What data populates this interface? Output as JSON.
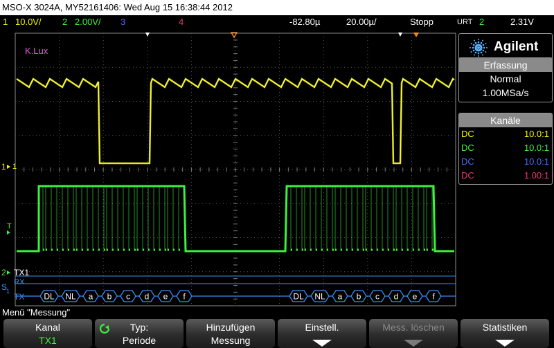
{
  "title_bar": "MSO-X 3024A, MY52161406: Wed Aug 15 16:38:44 2012",
  "status": {
    "ch1_num": "1",
    "ch1_scale": "10.0V/",
    "ch2_num": "2",
    "ch2_scale": "2.00V/",
    "ch3_num": "3",
    "ch4_num": "4",
    "delay": "-82.80µ",
    "timebase": "20.00µ/",
    "run_state": "Stopp",
    "trigger_label": "URT",
    "trigger_channel": "2",
    "trigger_level": "2.31V"
  },
  "colors": {
    "ch1": "#f2f200",
    "ch2": "#3cf23c",
    "ch3": "#4a6cf7",
    "ch4": "#f0357a",
    "serial_blue": "#3b8ff0",
    "trigger_orange": "#f08a20",
    "label_magenta": "#e060e0"
  },
  "screen": {
    "annotation": "K.Lux",
    "ch1_marker": "1",
    "ch2_marker": "2",
    "trigger_marker": "T",
    "serial_tx_label": "TX1",
    "serial_rx_label": "RX",
    "serial_tx_row": "TX",
    "serial_marker": "S",
    "serial_marker_sub": "1"
  },
  "decode_packets": [
    [
      "DL",
      "NL",
      "a",
      "b",
      "c",
      "d",
      "e",
      "f"
    ],
    [
      "DL",
      "NL",
      "a",
      "b",
      "c",
      "d",
      "e",
      "f"
    ]
  ],
  "side_panel": {
    "brand": "Agilent",
    "acquisition_header": "Erfassung",
    "acquisition_mode": "Normal",
    "sample_rate": "1.00MSa/s",
    "channels_header": "Kanäle",
    "channels": [
      {
        "coupling": "DC",
        "probe": "10.0:1",
        "color": "#f2f200"
      },
      {
        "coupling": "DC",
        "probe": "10.0:1",
        "color": "#3cf23c"
      },
      {
        "coupling": "DC",
        "probe": "10.0:1",
        "color": "#4a6cf7"
      },
      {
        "coupling": "DC",
        "probe": "1.00:1",
        "color": "#f0357a"
      }
    ]
  },
  "menu_label": "Menü \"Messung\"",
  "softkeys": [
    {
      "line1": "Kanal",
      "line2": "TX1"
    },
    {
      "line1": "Typ:",
      "line2": "Periode"
    },
    {
      "line1": "Hinzufügen",
      "line2": "Messung"
    },
    {
      "line1": "Einstell.",
      "line2": ""
    },
    {
      "line1": "Mess. löschen",
      "line2": ""
    },
    {
      "line1": "Statistiken",
      "line2": ""
    }
  ]
}
